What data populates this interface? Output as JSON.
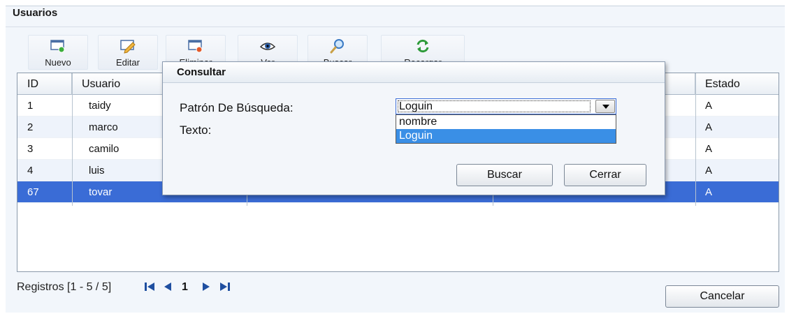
{
  "panel": {
    "title": "Usuarios"
  },
  "toolbar": {
    "nuevo": "Nuevo",
    "editar": "Editar",
    "eliminar": "Eliminar",
    "ver": "Ver",
    "buscar": "Buscar",
    "recargar": "Recargar"
  },
  "grid": {
    "headers": {
      "id": "ID",
      "usuario": "Usuario",
      "estado": "Estado"
    },
    "rows": [
      {
        "id": "1",
        "usuario": "taidy",
        "estado": "A"
      },
      {
        "id": "2",
        "usuario": "marco",
        "estado": "A"
      },
      {
        "id": "3",
        "usuario": "camilo",
        "estado": "A"
      },
      {
        "id": "4",
        "usuario": "luis",
        "estado": "A"
      },
      {
        "id": "67",
        "usuario": "tovar",
        "estado": "A"
      }
    ],
    "selected_row": 5
  },
  "footer": {
    "registros": "Registros [1 - 5 / 5]",
    "page": "1",
    "cancelar": "Cancelar"
  },
  "dialog": {
    "title": "Consultar",
    "patron_label": "Patrón De Búsqueda:",
    "texto_label": "Texto:",
    "select_value": "Loguin",
    "options": [
      "nombre",
      "Loguin"
    ],
    "buscar": "Buscar",
    "cerrar": "Cerrar"
  },
  "colors": {
    "selection": "#3a6cd6",
    "dropdown_highlight": "#3a8fe6",
    "panel_bg": "#f2f6fb"
  },
  "icons": {
    "nuevo": "new-document-icon",
    "editar": "edit-pencil-icon",
    "eliminar": "delete-document-icon",
    "ver": "eye-icon",
    "buscar": "magnifier-icon",
    "recargar": "refresh-icon",
    "first": "first-page-icon",
    "prev": "previous-page-icon",
    "next": "next-page-icon",
    "last": "last-page-icon"
  }
}
